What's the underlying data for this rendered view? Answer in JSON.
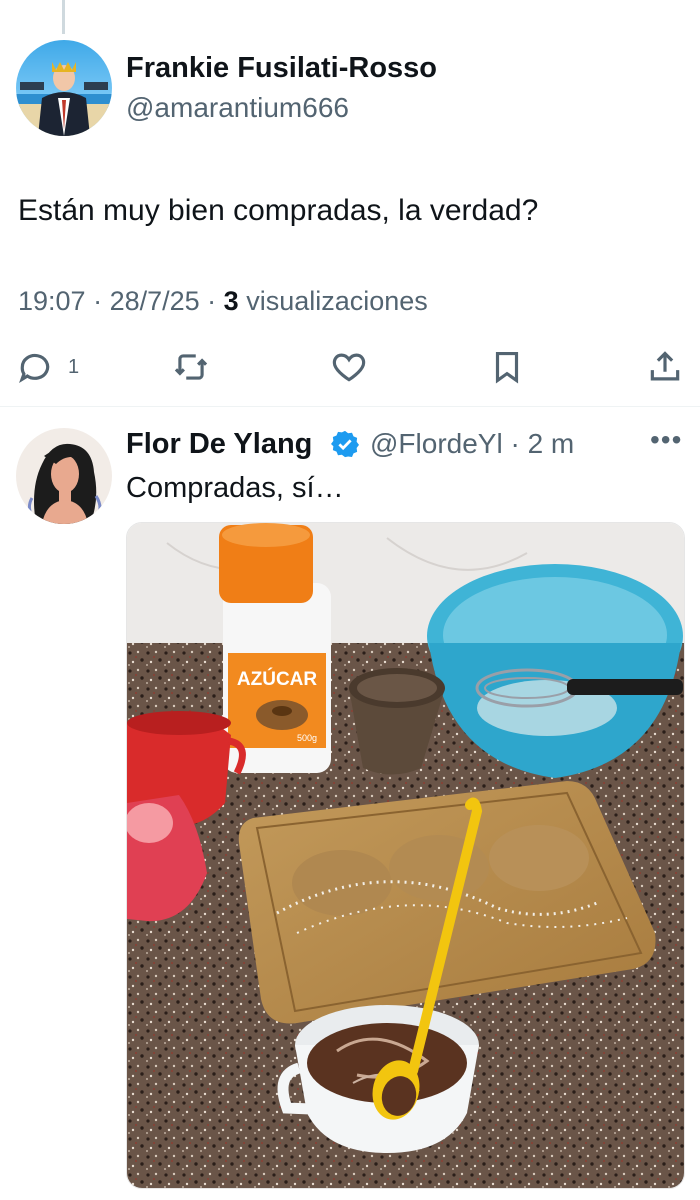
{
  "main_tweet": {
    "author_name": "Frankie Fusilati-Rosso",
    "handle": "@amarantium666",
    "text": "Están muy bien compradas, la verdad?",
    "time": "19:07",
    "date": "28/7/25",
    "views_count": "3",
    "views_label": "visualizaciones",
    "reply_count": "1"
  },
  "reply_tweet": {
    "author_name": "Flor De Ylang",
    "handle": "@FlordeYl",
    "age": "2 m",
    "text": "Compradas, sí…",
    "media": {
      "sugar_label": "AZÚCAR",
      "sugar_weight": "500g"
    }
  },
  "icons": {
    "reply": "reply-icon",
    "retweet": "retweet-icon",
    "like": "heart-icon",
    "bookmark": "bookmark-icon",
    "share": "share-icon",
    "verified": "verified-badge-icon",
    "more": "more-icon"
  },
  "colors": {
    "text": "#0f1419",
    "secondary": "#536471",
    "verified": "#1d9bf0",
    "divider": "#eff3f4"
  }
}
